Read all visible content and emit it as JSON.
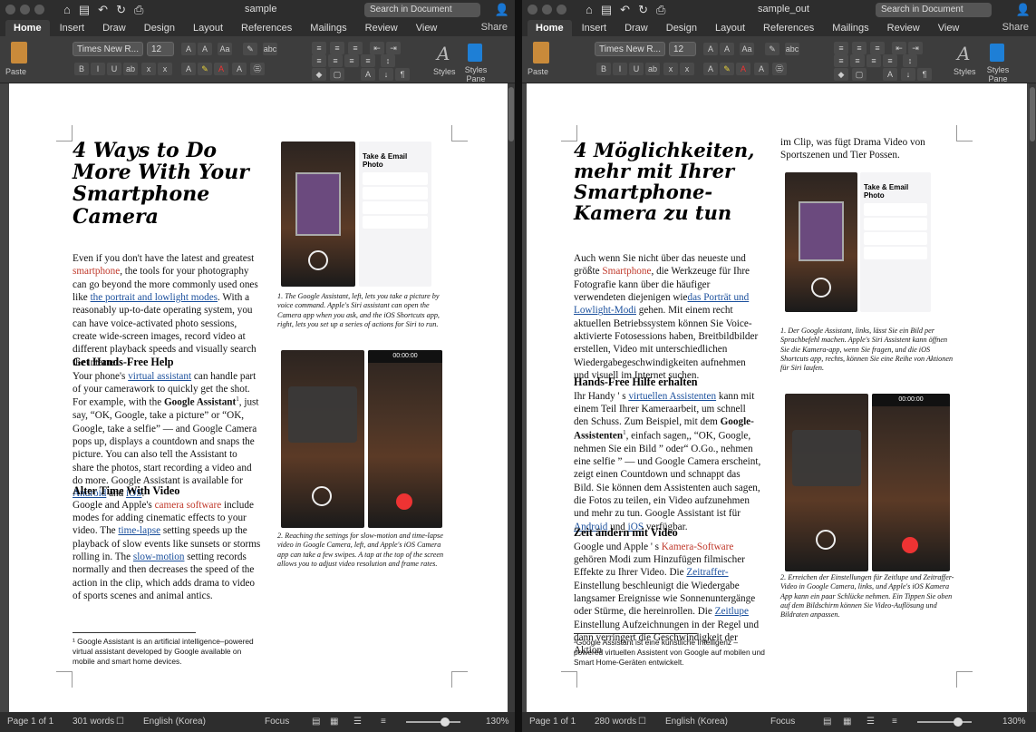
{
  "windows": [
    {
      "key": "left",
      "title": "sample",
      "search_placeholder": "Search in Document",
      "tabs": [
        "Home",
        "Insert",
        "Draw",
        "Design",
        "Layout",
        "References",
        "Mailings",
        "Review",
        "View"
      ],
      "share": "Share",
      "ribbon": {
        "paste": "Paste",
        "font_name": "Times New R...",
        "font_size": "12",
        "styles": "Styles",
        "styles_pane": "Styles Pane"
      },
      "article": {
        "title": "4 Ways to Do More With Your Smartphone Camera",
        "intro": [
          "Even if you don't have the latest and greatest ",
          "smartphone",
          ", the tools for your photography can go beyond the more commonly used ones like ",
          "the portrait and lowlight modes",
          ". With a reasonably up-to-date operating system, you can have voice-activated photo sessions, create wide-screen images, record video at different playback speeds and visually search the internet."
        ],
        "h1": "Get Hands-Free Help",
        "p1": [
          "Your phone's ",
          "virtual assistant",
          " can handle part of your camerawork to quickly get the shot. For example, with the ",
          "Google Assistant",
          "1",
          ", just say, “OK, Google, take a picture” or “OK, Google, take a selfie” — and Google Camera pops up, displays a countdown and snaps the picture. You can also tell the Assistant to share the photos, start recording a video and do more. Google Assistant is available for ",
          "Android",
          " and ",
          "iOS",
          "."
        ],
        "h2": "Alter Time With Video",
        "p2": [
          "Google and Apple's ",
          "camera software",
          " include modes for adding cinematic effects to your video. The ",
          "time-lapse",
          " setting speeds up the playback of slow events like sunsets or storms rolling in. The ",
          "slow-motion",
          " setting records normally and then decreases the speed of the action in the clip, which adds drama to video of sports scenes and animal antics."
        ],
        "caption1": "1. The Google Assistant, left, lets you take a picture by voice command. Apple's Siri assistant can open the Camera app when you ask, and the iOS Shortcuts app, right, lets you set up a series of actions for Siri to run.",
        "caption2": "2. Reaching the settings for slow-motion and time-lapse video in Google Camera, left, and Apple's iOS Camera app can take a few swipes. A tap at the top of the screen allows you to adjust video resolution and frame rates.",
        "footnote": "¹ Google Assistant is an artificial intelligence–powered virtual assistant developed by Google available on mobile and smart home devices.",
        "phone_header": "Take & Email Photo",
        "timer": "00:00:00"
      },
      "status": {
        "page": "Page 1 of 1",
        "words": "301 words",
        "lang": "English (Korea)",
        "focus": "Focus",
        "zoom": "130%"
      }
    },
    {
      "key": "right",
      "title": "sample_out",
      "search_placeholder": "Search in Document",
      "tabs": [
        "Home",
        "Insert",
        "Draw",
        "Design",
        "Layout",
        "References",
        "Mailings",
        "Review",
        "View"
      ],
      "share": "Share",
      "ribbon": {
        "paste": "Paste",
        "font_name": "Times New R...",
        "font_size": "12",
        "styles": "Styles",
        "styles_pane": "Styles Pane"
      },
      "article": {
        "title": "4 Möglichkeiten, mehr mit Ihrer Smartphone-Kamera zu tun",
        "intro": [
          "Auch wenn Sie nicht über das neueste und größte ",
          "Smartphone",
          ", die Werkzeuge für Ihre Fotografie kann über die häufiger verwendeten diejenigen wie",
          "das Porträt und Lowlight-Modi",
          " gehen. Mit einem recht aktuellen Betriebssystem können Sie Voice-aktivierte Fotosessions haben, Breitbildbilder erstellen, Video mit unterschiedlichen Wiedergabegeschwindigkeiten aufnehmen und visuell im Internet suchen."
        ],
        "h1": "Hands-Free Hilfe erhalten",
        "p1": [
          "Ihr Handy ' s ",
          "virtuellen Assistenten",
          " kann mit einem Teil Ihrer Kameraarbeit, um schnell den Schuss. Zum Beispiel, mit dem ",
          "Google-Assistenten",
          "1",
          ", einfach sagen,, “OK, Google, nehmen Sie ein Bild ” oder“ O.Go., nehmen eine selfie ” — und Google Camera erscheint, zeigt einen Countdown und schnappt das Bild. Sie können dem Assistenten auch sagen, die Fotos zu teilen, ein Video aufzunehmen und mehr zu tun. Google Assistant ist für",
          " Android",
          " und ",
          "iOS",
          " verfügbar."
        ],
        "h2": "Zeit ändern mit Video",
        "p2": [
          "Google und Apple ' s ",
          "Kamera-Software",
          " gehören Modi zum Hinzufügen filmischer Effekte zu Ihrer Video. Die ",
          "Zeitraffer-",
          " Einstellung beschleunigt die Wiedergabe langsamer Ereignisse wie Sonnenuntergänge oder Stürme, die hereinrollen. Die ",
          "Zeitlupe",
          " Einstellung Aufzeichnungen in der Regel und dann verringert die Geschwindigkeit der Aktion"
        ],
        "p3": "im Clip, was fügt Drama Video von Sportszenen und Tier Possen.",
        "caption1": "1. Der Google Assistant, links, lässt Sie ein Bild per Sprachbefehl machen. Apple's Siri Assistent kann öffnen Sie die Kamera-app, wenn Sie fragen, und die iOS Shortcuts app, rechts, können Sie eine Reihe von Aktionen für Siri laufen.",
        "caption2": "2. Erreichen der Einstellungen für Zeitlupe und Zeitraffer-Video in Google Camera, links, und Apple's iOS Kamera App kann ein paar Schlücke nehmen. Ein Tippen Sie oben auf dem Bildschirm können Sie Video-Auflösung und Bildraten anpassen.",
        "footnote": "¹Google Assistant ist eine künstliche Intelligenz – powered virtuellen Assistent von Google auf mobilen und Smart Home-Geräten entwickelt.",
        "phone_header": "Take & Email Photo",
        "timer": "00:00:00"
      },
      "status": {
        "page": "Page 1 of 1",
        "words": "280 words",
        "lang": "English (Korea)",
        "focus": "Focus",
        "zoom": "130%"
      }
    }
  ]
}
